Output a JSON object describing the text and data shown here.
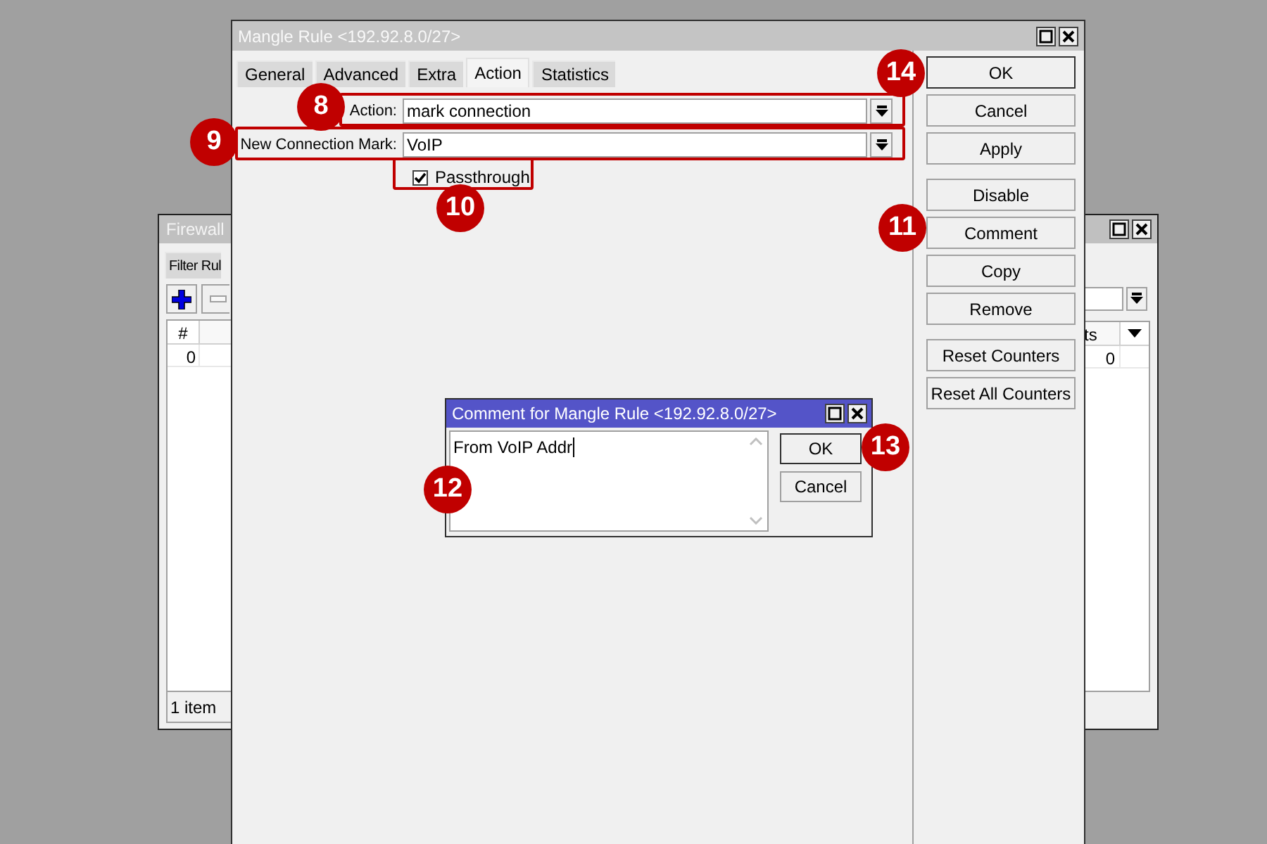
{
  "firewall_window": {
    "title": "Firewall",
    "tab": "Filter Rul",
    "columns": [
      {
        "label": "#"
      },
      {
        "label": "ts"
      }
    ],
    "row": [
      "0",
      "0"
    ],
    "status": "1 item"
  },
  "mangle_window": {
    "title": "Mangle Rule <192.92.8.0/27>",
    "tabs": [
      {
        "label": "General",
        "selected": false
      },
      {
        "label": "Advanced",
        "selected": false
      },
      {
        "label": "Extra",
        "selected": false
      },
      {
        "label": "Action",
        "selected": true
      },
      {
        "label": "Statistics",
        "selected": false
      }
    ],
    "fields": [
      {
        "label": "Action:",
        "value": "mark connection",
        "highlighted": true,
        "callout": "8"
      },
      {
        "label": "New Connection Mark:",
        "value": "VoIP",
        "highlighted": true,
        "callout": "9"
      }
    ],
    "passthrough": {
      "label": "Passthrough",
      "checked": true,
      "highlighted": true,
      "callout": "10"
    },
    "button_groups": [
      [
        {
          "label": "OK",
          "default": true,
          "callout": "14"
        },
        {
          "label": "Cancel",
          "default": false
        },
        {
          "label": "Apply",
          "default": false
        }
      ],
      [
        {
          "label": "Disable",
          "default": false
        },
        {
          "label": "Comment",
          "default": false,
          "callout": "11"
        },
        {
          "label": "Copy",
          "default": false
        },
        {
          "label": "Remove",
          "default": false
        }
      ],
      [
        {
          "label": "Reset Counters",
          "default": false
        },
        {
          "label": "Reset All Counters",
          "default": false
        }
      ]
    ]
  },
  "comment_dialog": {
    "title": "Comment for Mangle Rule <192.92.8.0/27>",
    "value": "From VoIP Addr",
    "callout": "12",
    "buttons": [
      {
        "label": "OK",
        "default": true,
        "callout": "13"
      },
      {
        "label": "Cancel",
        "default": false
      }
    ]
  }
}
